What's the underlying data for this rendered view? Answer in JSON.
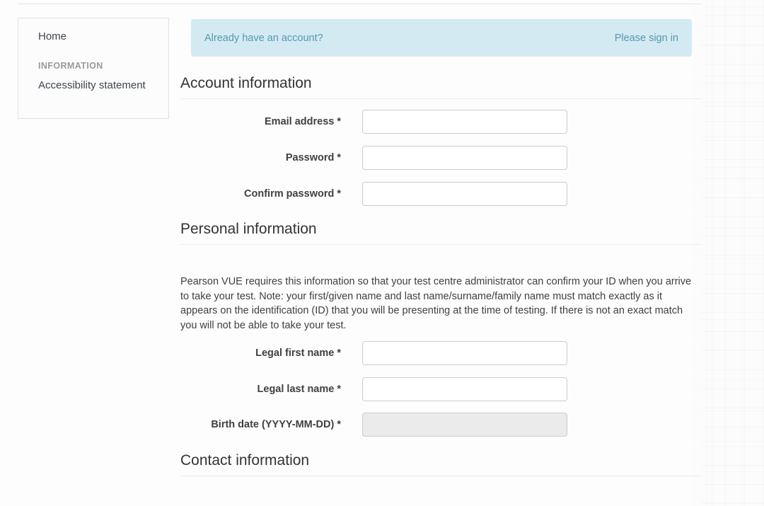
{
  "sidebar": {
    "home_label": "Home",
    "section_heading": "INFORMATION",
    "accessibility_label": "Accessibility statement"
  },
  "alert": {
    "message": "Already have an account?",
    "link_label": "Please sign in",
    "background_color": "#d4eaf3",
    "text_color": "#5797b0"
  },
  "sections": {
    "account_heading": "Account information",
    "personal_heading": "Personal information",
    "contact_heading": "Contact information"
  },
  "personal_intro": "Pearson VUE requires this information so that your test centre administrator can confirm your ID when you arrive to take your test. Note: your first/given name and last name/surname/family name must match exactly as it appears on the identification (ID) that you will be presenting at the time of testing. If there is not an exact match you will not be able to take your test.",
  "fields": {
    "email": {
      "label": "Email address *",
      "value": "",
      "placeholder": ""
    },
    "password": {
      "label": "Password *",
      "value": "",
      "placeholder": ""
    },
    "confirm_password": {
      "label": "Confirm password *",
      "value": "",
      "placeholder": ""
    },
    "legal_first_name": {
      "label": "Legal first name *",
      "value": "",
      "placeholder": ""
    },
    "legal_last_name": {
      "label": "Legal last name *",
      "value": "",
      "placeholder": ""
    },
    "birth_date": {
      "label": "Birth date (YYYY-MM-DD) *",
      "value": "",
      "placeholder": ""
    }
  }
}
